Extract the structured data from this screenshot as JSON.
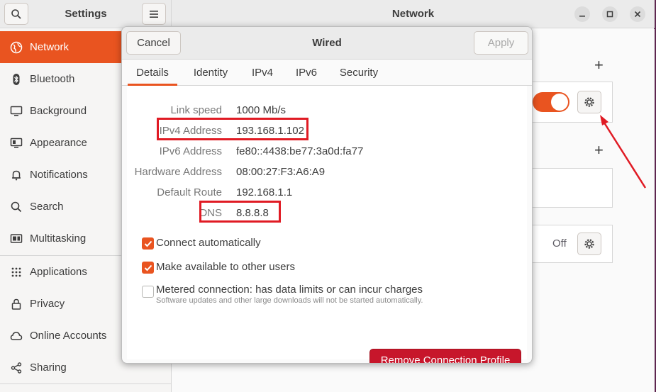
{
  "settings_window": {
    "title": "Settings",
    "panel_title": "Network"
  },
  "sidebar": {
    "items": [
      {
        "label": "Network",
        "icon": "globe-icon"
      },
      {
        "label": "Bluetooth",
        "icon": "bluetooth-icon"
      },
      {
        "label": "Background",
        "icon": "monitor-icon"
      },
      {
        "label": "Appearance",
        "icon": "appearance-icon"
      },
      {
        "label": "Notifications",
        "icon": "bell-icon"
      },
      {
        "label": "Search",
        "icon": "search-icon"
      },
      {
        "label": "Multitasking",
        "icon": "multitasking-icon"
      },
      {
        "label": "Applications",
        "icon": "grid-icon"
      },
      {
        "label": "Privacy",
        "icon": "lock-icon"
      },
      {
        "label": "Online Accounts",
        "icon": "cloud-icon"
      },
      {
        "label": "Sharing",
        "icon": "share-icon"
      }
    ],
    "active": "Network"
  },
  "main": {
    "vpn_status": "Off"
  },
  "dialog": {
    "title": "Wired",
    "cancel_label": "Cancel",
    "apply_label": "Apply",
    "tabs": [
      "Details",
      "Identity",
      "IPv4",
      "IPv6",
      "Security"
    ],
    "active_tab": "Details",
    "details": [
      {
        "label": "Link speed",
        "value": "1000 Mb/s"
      },
      {
        "label": "IPv4 Address",
        "value": "193.168.1.102"
      },
      {
        "label": "IPv6 Address",
        "value": "fe80::4438:be77:3a0d:fa77"
      },
      {
        "label": "Hardware Address",
        "value": "08:00:27:F3:A6:A9"
      },
      {
        "label": "Default Route",
        "value": "192.168.1.1"
      },
      {
        "label": "DNS",
        "value": "8.8.8.8"
      }
    ],
    "options": {
      "connect_automatically": {
        "label": "Connect automatically",
        "checked": true
      },
      "available_to_others": {
        "label": "Make available to other users",
        "checked": true
      },
      "metered": {
        "label": "Metered connection: has data limits or can incur charges",
        "sublabel": "Software updates and other large downloads will not be started automatically.",
        "checked": false
      }
    },
    "remove_label": "Remove Connection Profile"
  },
  "colors": {
    "accent": "#e95420",
    "danger": "#c7162b",
    "annotation": "#e01b24"
  }
}
